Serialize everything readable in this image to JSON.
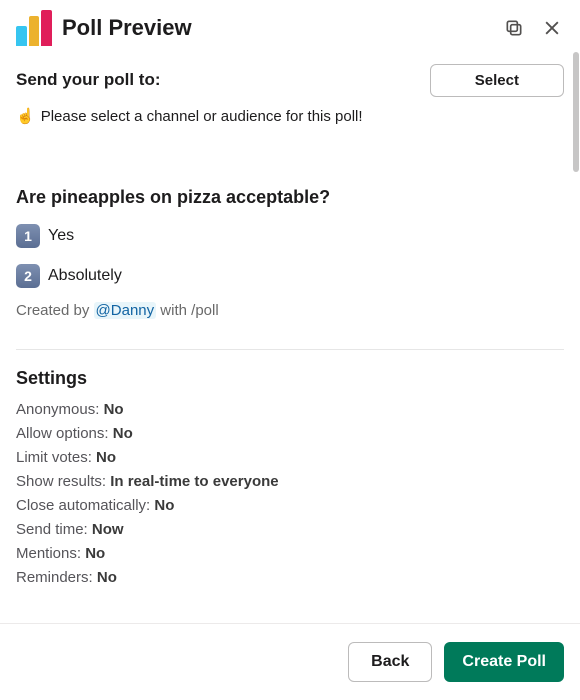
{
  "header": {
    "title": "Poll Preview"
  },
  "send": {
    "label": "Send your poll to:",
    "select_button": "Select",
    "hint_emoji": "☝️",
    "hint_text": "Please select a channel or audience for this poll!"
  },
  "poll": {
    "question": "Are pineapples on pizza acceptable?",
    "options": [
      {
        "num": "1",
        "label": "Yes"
      },
      {
        "num": "2",
        "label": "Absolutely"
      }
    ],
    "created_by_prefix": "Created by ",
    "created_by_user": "@Danny",
    "created_by_suffix": " with /poll"
  },
  "settings": {
    "title": "Settings",
    "rows": [
      {
        "label": "Anonymous:",
        "value": "No"
      },
      {
        "label": "Allow options:",
        "value": "No"
      },
      {
        "label": "Limit votes:",
        "value": "No"
      },
      {
        "label": "Show results:",
        "value": "In real-time to everyone"
      },
      {
        "label": "Close automatically:",
        "value": "No"
      },
      {
        "label": "Send time:",
        "value": "Now"
      },
      {
        "label": "Mentions:",
        "value": "No"
      },
      {
        "label": "Reminders:",
        "value": "No"
      }
    ]
  },
  "footer": {
    "back": "Back",
    "create": "Create Poll"
  }
}
